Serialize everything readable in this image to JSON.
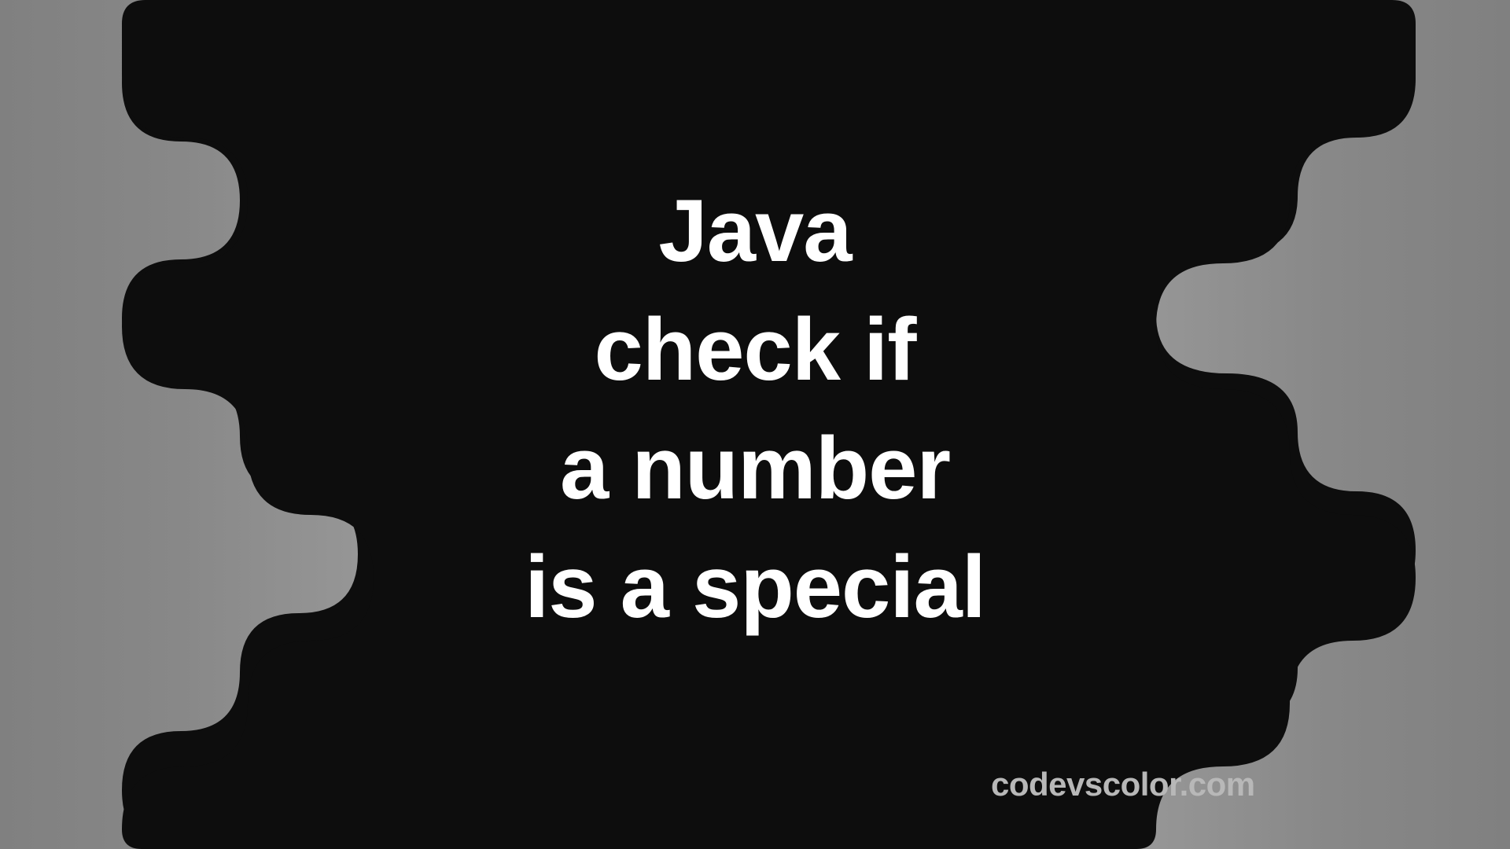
{
  "title": {
    "line1": "Java",
    "line2": "check if",
    "line3": "a number",
    "line4": "is a special"
  },
  "site": "codevscolor.com",
  "colors": {
    "blob": "#0d0d0d",
    "text": "#ffffff",
    "site": "#b8b8b8"
  }
}
